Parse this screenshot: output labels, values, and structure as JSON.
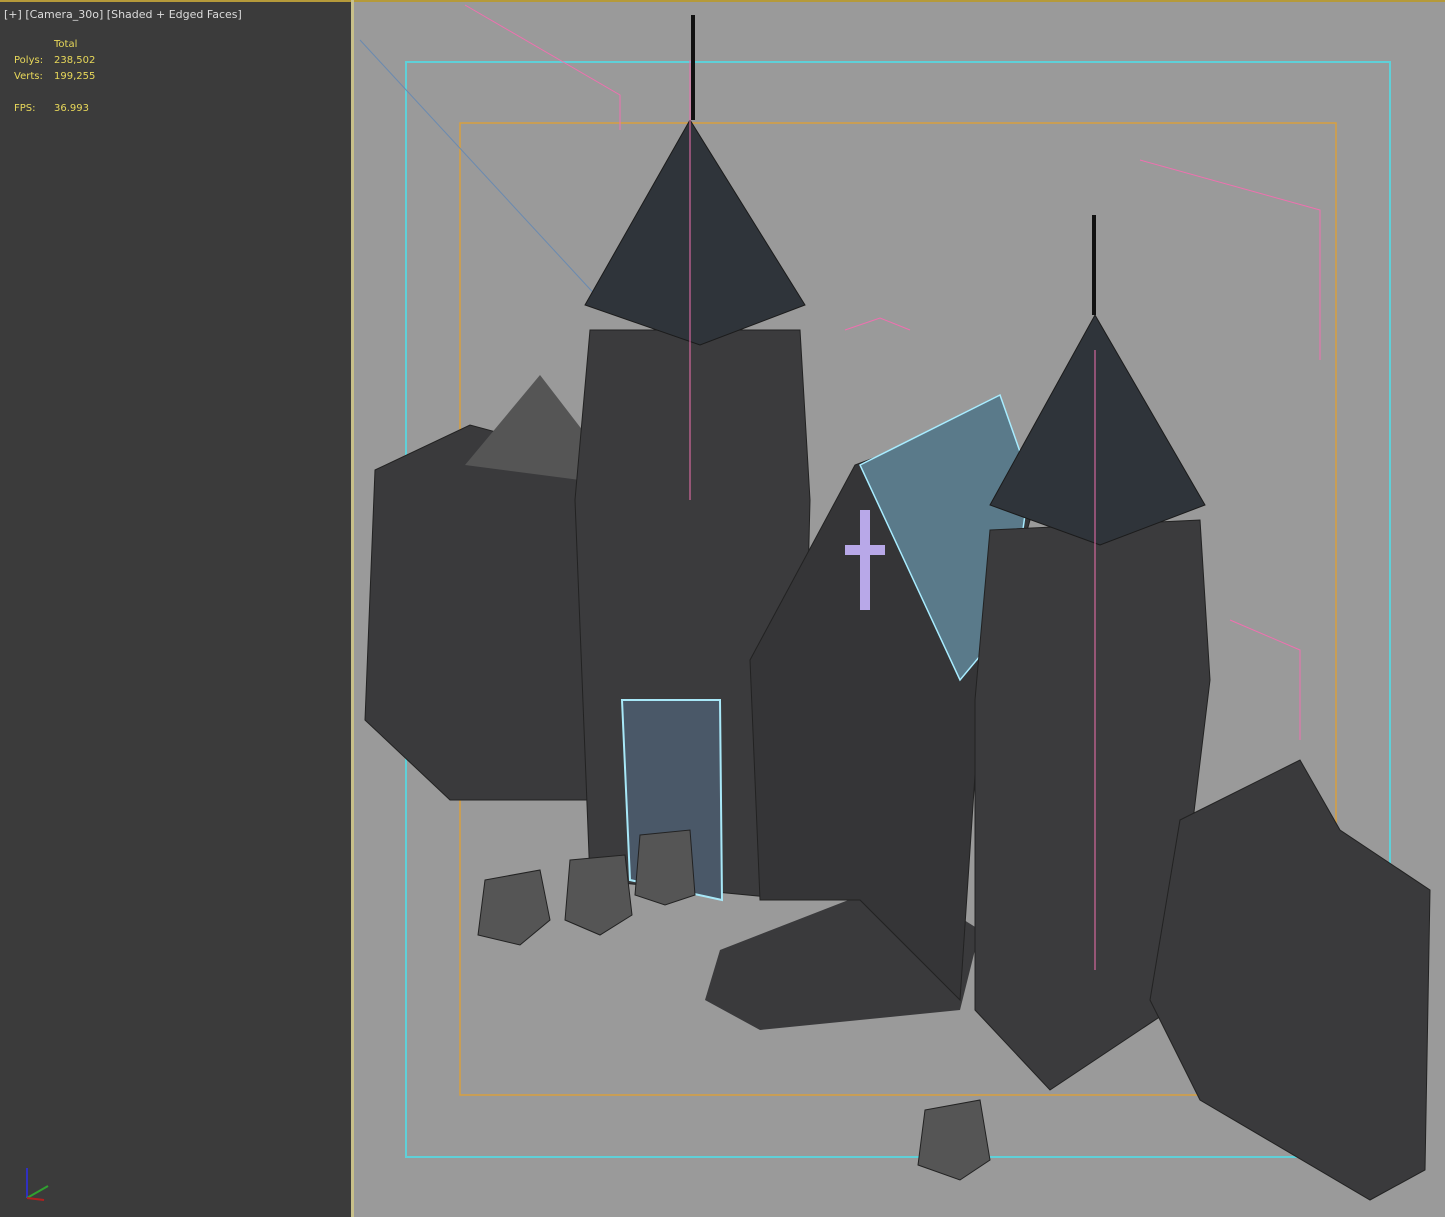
{
  "viewport": {
    "label_plus": "[+]",
    "label_camera": "[Camera_30o]",
    "label_mode": "[Shaded + Edged Faces]"
  },
  "stats": {
    "header": "Total",
    "polys_label": "Polys:",
    "polys_value": "238,502",
    "verts_label": "Verts:",
    "verts_value": "199,255",
    "fps_label": "FPS:",
    "fps_value": "36.993"
  },
  "colors": {
    "safe_frame": "#5fd0d8",
    "render_frame": "#d8a040",
    "bounding": "#f070b0",
    "stone": "#3c3c3e",
    "roof": "#2e3238"
  }
}
